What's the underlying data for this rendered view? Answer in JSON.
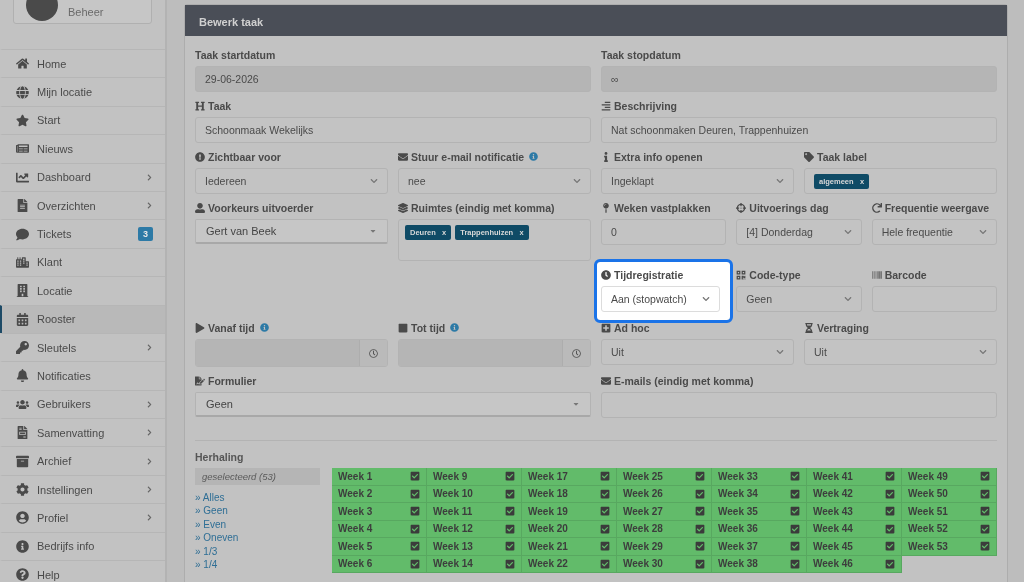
{
  "profile": {
    "role": "Beheer"
  },
  "sidebar": {
    "items": [
      {
        "label": "Home",
        "selected": false,
        "submenu": false
      },
      {
        "label": "Mijn locatie",
        "selected": false,
        "submenu": false
      },
      {
        "label": "Start",
        "selected": false,
        "submenu": false
      },
      {
        "label": "Nieuws",
        "selected": false,
        "submenu": false
      },
      {
        "label": "Dashboard",
        "selected": false,
        "submenu": true
      },
      {
        "label": "Overzichten",
        "selected": false,
        "submenu": true
      },
      {
        "label": "Tickets",
        "selected": false,
        "submenu": false,
        "badge": "3"
      },
      {
        "label": "Klant",
        "selected": false,
        "submenu": false
      },
      {
        "label": "Locatie",
        "selected": false,
        "submenu": false
      },
      {
        "label": "Rooster",
        "selected": true,
        "submenu": false
      },
      {
        "label": "Sleutels",
        "selected": false,
        "submenu": true
      },
      {
        "label": "Notificaties",
        "selected": false,
        "submenu": false
      },
      {
        "label": "Gebruikers",
        "selected": false,
        "submenu": true
      },
      {
        "label": "Samenvatting",
        "selected": false,
        "submenu": true
      },
      {
        "label": "Archief",
        "selected": false,
        "submenu": true
      },
      {
        "label": "Instellingen",
        "selected": false,
        "submenu": true
      },
      {
        "label": "Profiel",
        "selected": false,
        "submenu": true
      },
      {
        "label": "Bedrijfs info",
        "selected": false,
        "submenu": false
      },
      {
        "label": "Help",
        "selected": false,
        "submenu": false
      }
    ]
  },
  "panel": {
    "title": "Bewerk taak",
    "rows": [
      [
        {
          "label": "Taak startdatum",
          "kind": "readonly",
          "value": "29-06-2026"
        },
        {
          "label": "Taak stopdatum",
          "kind": "readonly",
          "value": "∞"
        }
      ],
      [
        {
          "label": "Taak",
          "kind": "text",
          "value": "Schoonmaak Wekelijks"
        },
        {
          "label": "Beschrijving",
          "kind": "text",
          "value": "Nat schoonmaken Deuren, Trappenhuizen"
        }
      ],
      [
        {
          "label": "Zichtbaar voor",
          "kind": "select",
          "value": "Iedereen"
        },
        {
          "label": "Stuur e-mail notificatie",
          "kind": "select",
          "value": "nee",
          "info": true
        },
        {
          "label": "Extra info openen",
          "kind": "select",
          "value": "Ingeklapt"
        },
        {
          "label": "Taak label",
          "kind": "tags",
          "tags": [
            {
              "label": "algemeen",
              "remove": "x"
            }
          ]
        }
      ],
      [
        {
          "label": "Voorkeurs uitvoerder",
          "kind": "dropdown",
          "value": "Gert van Beek"
        },
        {
          "label": "Ruimtes (eindig met komma)",
          "kind": "tags",
          "tags": [
            {
              "label": "Deuren",
              "remove": "x"
            },
            {
              "label": "Trappenhuizen",
              "remove": "x"
            }
          ],
          "tall": true
        },
        {
          "label": "Weken vastplakken",
          "kind": "text",
          "value": "0"
        },
        {
          "label": "Uitvoerings dag",
          "kind": "select",
          "value": "[4] Donderdag"
        },
        {
          "label": "Frequentie weergave",
          "kind": "select",
          "value": "Hele frequentie"
        }
      ],
      [
        "",
        "",
        {
          "label": "Tijdregistratie",
          "kind": "select",
          "value": "Aan (stopwatch)",
          "highlighted": true
        },
        {
          "label": "Code-type",
          "kind": "select",
          "value": "Geen"
        },
        {
          "label": "Barcode",
          "kind": "text"
        }
      ],
      [
        {
          "label": "Vanaf tijd",
          "kind": "time",
          "info": true
        },
        {
          "label": "Tot tijd",
          "kind": "time",
          "info": true
        },
        {
          "label": "Ad hoc",
          "kind": "select",
          "value": "Uit"
        },
        {
          "label": "Vertraging",
          "kind": "select",
          "value": "Uit"
        }
      ],
      [
        {
          "label": "Formulier",
          "kind": "dropdown",
          "value": "Geen"
        },
        {
          "label": "E-mails (eindig met komma)",
          "kind": "text"
        }
      ]
    ],
    "repeat": {
      "label": "Herhaling",
      "selected_count": "geselecteerd (53)",
      "links": [
        "» Alles",
        "» Geen",
        "» Even",
        "» Oneven",
        "» 1/3",
        "» 1/4"
      ],
      "columns": [
        [
          {
            "label": "Week 1",
            "checked": true
          },
          {
            "label": "Week 2",
            "checked": true
          },
          {
            "label": "Week 3",
            "checked": true
          },
          {
            "label": "Week 4",
            "checked": true
          },
          {
            "label": "Week 5",
            "checked": true
          },
          {
            "label": "Week 6",
            "checked": true
          }
        ],
        [
          {
            "label": "Week 9",
            "checked": true
          },
          {
            "label": "Week 10",
            "checked": true
          },
          {
            "label": "Week 11",
            "checked": true
          },
          {
            "label": "Week 12",
            "checked": true
          },
          {
            "label": "Week 13",
            "checked": true
          },
          {
            "label": "Week 14",
            "checked": true
          }
        ],
        [
          {
            "label": "Week 17",
            "checked": true
          },
          {
            "label": "Week 18",
            "checked": true
          },
          {
            "label": "Week 19",
            "checked": true
          },
          {
            "label": "Week 20",
            "checked": true
          },
          {
            "label": "Week 21",
            "checked": true
          },
          {
            "label": "Week 22",
            "checked": true
          }
        ],
        [
          {
            "label": "Week 25",
            "checked": true
          },
          {
            "label": "Week 26",
            "checked": true
          },
          {
            "label": "Week 27",
            "checked": true
          },
          {
            "label": "Week 28",
            "checked": true
          },
          {
            "label": "Week 29",
            "checked": true
          },
          {
            "label": "Week 30",
            "checked": true
          }
        ],
        [
          {
            "label": "Week 33",
            "checked": true
          },
          {
            "label": "Week 34",
            "checked": true
          },
          {
            "label": "Week 35",
            "checked": true
          },
          {
            "label": "Week 36",
            "checked": true
          },
          {
            "label": "Week 37",
            "checked": true
          },
          {
            "label": "Week 38",
            "checked": true
          }
        ],
        [
          {
            "label": "Week 41",
            "checked": true
          },
          {
            "label": "Week 42",
            "checked": true
          },
          {
            "label": "Week 43",
            "checked": true
          },
          {
            "label": "Week 44",
            "checked": true
          },
          {
            "label": "Week 45",
            "checked": true
          },
          {
            "label": "Week 46",
            "checked": true
          }
        ],
        [
          {
            "label": "Week 49",
            "checked": true
          },
          {
            "label": "Week 50",
            "checked": true
          },
          {
            "label": "Week 51",
            "checked": true
          },
          {
            "label": "Week 52",
            "checked": true
          },
          {
            "label": "Week 53",
            "checked": true
          }
        ]
      ]
    }
  }
}
